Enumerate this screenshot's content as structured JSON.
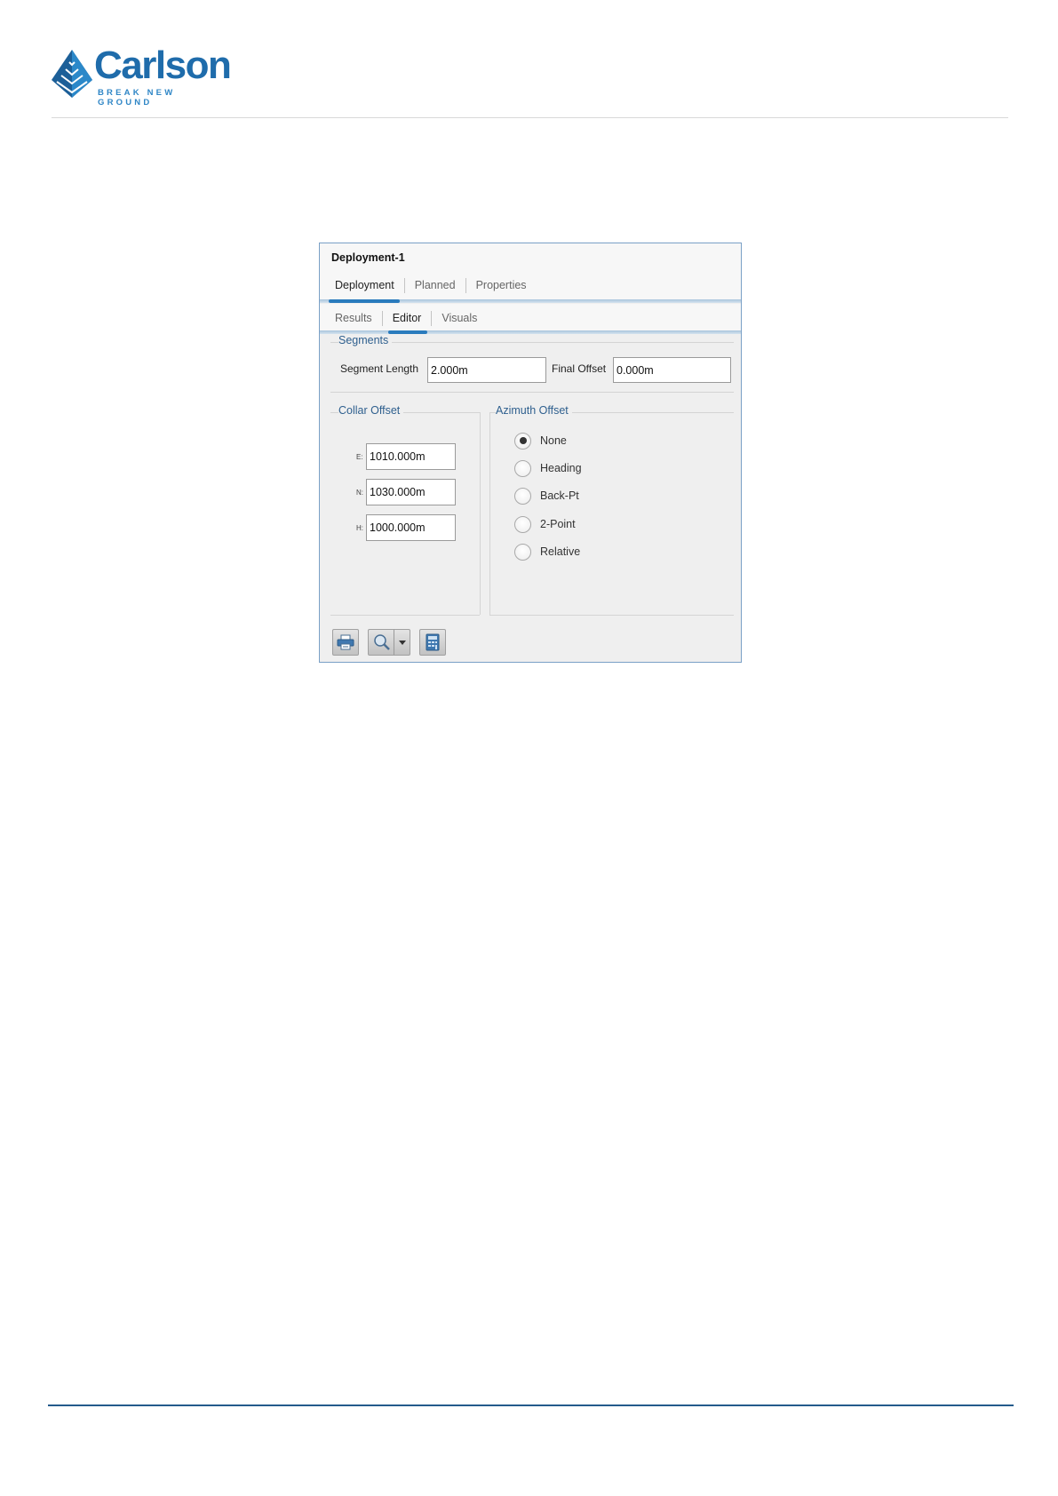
{
  "logo": {
    "name": "Carlson",
    "tagline": "BREAK NEW GROUND",
    "brand_color": "#1f6cab"
  },
  "dialog": {
    "title": "Deployment-1",
    "main_tabs": [
      {
        "label": "Deployment",
        "active": true
      },
      {
        "label": "Planned",
        "active": false
      },
      {
        "label": "Properties",
        "active": false
      }
    ],
    "sub_tabs": [
      {
        "label": "Results",
        "active": false
      },
      {
        "label": "Editor",
        "active": true
      },
      {
        "label": "Visuals",
        "active": false
      }
    ],
    "segments": {
      "title": "Segments",
      "segment_length_label": "Segment Length",
      "segment_length_value": "2.000m",
      "final_offset_label": "Final Offset",
      "final_offset_value": "0.000m"
    },
    "collar_offset": {
      "title": "Collar Offset",
      "fields": [
        {
          "label": "E:",
          "value": "1010.000m"
        },
        {
          "label": "N:",
          "value": "1030.000m"
        },
        {
          "label": "H:",
          "value": "1000.000m"
        }
      ]
    },
    "azimuth_offset": {
      "title": "Azimuth Offset",
      "selected": "None",
      "options": [
        "None",
        "Heading",
        "Back-Pt",
        "2-Point",
        "Relative"
      ]
    },
    "toolbar": {
      "buttons": [
        {
          "icon": "printer-icon"
        },
        {
          "icon": "magnifier-icon",
          "dropdown": true
        },
        {
          "icon": "calculator-icon"
        }
      ]
    }
  },
  "colors": {
    "accent": "#2a7bbd",
    "group_title": "#2e5f8e",
    "footer_rule": "#245b8c"
  }
}
